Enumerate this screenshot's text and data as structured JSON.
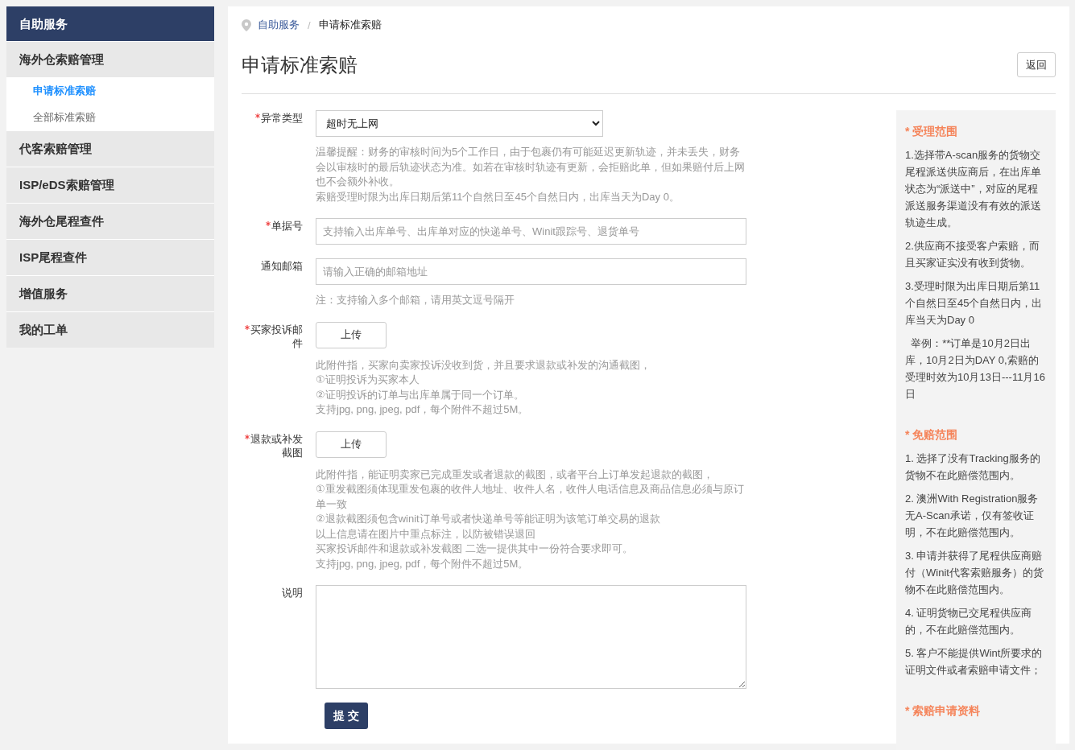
{
  "sidebar": {
    "header": "自助服务",
    "items": [
      {
        "label": "海外仓索赔管理",
        "kind": "group",
        "children": [
          {
            "label": "申请标准索赔",
            "selected": true
          },
          {
            "label": "全部标准索赔",
            "selected": false
          }
        ]
      },
      {
        "label": "代客索赔管理",
        "kind": "group"
      },
      {
        "label": "ISP/eDS索赔管理",
        "kind": "group"
      },
      {
        "label": "海外仓尾程查件",
        "kind": "group"
      },
      {
        "label": "ISP尾程查件",
        "kind": "group"
      },
      {
        "label": "增值服务",
        "kind": "group"
      },
      {
        "label": "我的工单",
        "kind": "group"
      }
    ]
  },
  "breadcrumb": [
    {
      "label": "自助服务",
      "kind": "link"
    },
    {
      "label": "申请标准索赔",
      "kind": "current"
    }
  ],
  "breadcrumb_separator": "/",
  "page_title": "申请标准索赔",
  "back_button": "返回",
  "form": {
    "fields": [
      {
        "kind": "select",
        "label": "异常类型",
        "required": true,
        "value": "超时无上网",
        "hints": [
          "温馨提醒：财务的审核时间为5个工作日，由于包裹仍有可能延迟更新轨迹，并未丢失，财务会以审核时的最后轨迹状态为准。如若在审核时轨迹有更新，会拒赔此单，但如果赔付后上网也不会额外补收。",
          "索赔受理时限为出库日期后第11个自然日至45个自然日内，出库当天为Day 0。"
        ]
      },
      {
        "kind": "input",
        "label": "单据号",
        "required": true,
        "placeholder": "支持输入出库单号、出库单对应的快递单号、Winit跟踪号、退货单号"
      },
      {
        "kind": "input",
        "label": "通知邮箱",
        "required": false,
        "placeholder": "请输入正确的邮箱地址",
        "hints": [
          "注：支持输入多个邮箱，请用英文逗号隔开"
        ]
      },
      {
        "kind": "upload",
        "label": "买家投诉邮件",
        "required": true,
        "button": "上传",
        "hints": [
          "此附件指，买家向卖家投诉没收到货，并且要求退款或补发的沟通截图，",
          "①证明投诉为买家本人",
          "②证明投诉的订单与出库单属于同一个订单。",
          "支持jpg, png, jpeg, pdf，每个附件不超过5M。"
        ]
      },
      {
        "kind": "upload",
        "label": "退款或补发截图",
        "required": true,
        "button": "上传",
        "hints": [
          "此附件指，能证明卖家已完成重发或者退款的截图，或者平台上订单发起退款的截图，",
          "①重发截图须体现重发包裹的收件人地址、收件人名，收件人电话信息及商品信息必须与原订单一致",
          "②退款截图须包含winit订单号或者快递单号等能证明为该笔订单交易的退款",
          "以上信息请在图片中重点标注，以防被错误退回",
          "买家投诉邮件和退款或补发截图 二选一提供其中一份符合要求即可。",
          "支持jpg, png, jpeg, pdf，每个附件不超过5M。"
        ]
      },
      {
        "kind": "textarea",
        "label": "说明",
        "required": false
      }
    ],
    "submit": "提 交"
  },
  "info": [
    {
      "title": "* 受理范围",
      "paragraphs": [
        "1.选择带A-scan服务的货物交尾程派送供应商后，在出库单状态为“派送中”，对应的尾程派送服务渠道没有有效的派送轨迹生成。",
        "2.供应商不接受客户索赔，而且买家证实没有收到货物。",
        "3.受理时限为出库日期后第11个自然日至45个自然日内，出库当天为Day 0",
        "  举例：**订单是10月2日出库，10月2日为DAY 0,索赔的受理时效为10月13日---11月16日"
      ]
    },
    {
      "title": "* 免赔范围",
      "paragraphs": [
        "1. 选择了没有Tracking服务的货物不在此赔偿范围内。",
        "2. 澳洲With Registration服务无A-Scan承诺，仅有签收证明，不在此赔偿范围内。",
        "3. 申请并获得了尾程供应商赔付（Winit代客索赔服务）的货物不在此赔偿范围内。",
        "4. 证明货物已交尾程供应商的，不在此赔偿范围内。",
        "5. 客户不能提供Wint所要求的证明文件或者索赔申请文件；"
      ]
    },
    {
      "title": "* 索赔申请资料"
    }
  ]
}
